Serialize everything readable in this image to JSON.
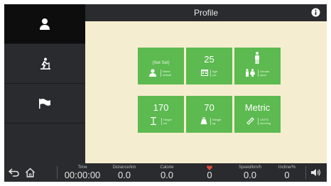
{
  "header": {
    "title": "Profile",
    "info_icon": "info-icon"
  },
  "sidebar": {
    "items": [
      {
        "name": "profile",
        "icon": "user-icon",
        "active": true
      },
      {
        "name": "workout",
        "icon": "treadmill-runner-icon",
        "active": false
      },
      {
        "name": "goals",
        "icon": "flag-icon",
        "active": false
      }
    ]
  },
  "tiles": [
    {
      "value": "(Not Set)",
      "label": "Name",
      "sublabel": "default",
      "icon": "user-icon"
    },
    {
      "value": "25",
      "label": "Age",
      "sublabel": "yrs",
      "icon": "calendar-icon"
    },
    {
      "value": "",
      "label": "Gender",
      "sublabel": "sport",
      "icon": "male-female-icon"
    },
    {
      "value": "170",
      "label": "Height",
      "sublabel": "cm",
      "icon": "height-icon"
    },
    {
      "value": "70",
      "label": "Weight",
      "sublabel": "kg",
      "icon": "weight-icon"
    },
    {
      "value": "Metric",
      "label": "UNITS",
      "sublabel": "km/m/kg",
      "icon": "ruler-icon"
    }
  ],
  "bottombar": {
    "time": {
      "label": "Time",
      "value": "00:00:00"
    },
    "distance": {
      "label": "Distance/km",
      "value": "0.0"
    },
    "calorie": {
      "label": "Calorie",
      "value": "0.0"
    },
    "heart": {
      "value": "0"
    },
    "speed": {
      "label": "Speed/km/h",
      "value": "0.0"
    },
    "incline": {
      "label": "Incline/%",
      "value": "0"
    }
  },
  "colors": {
    "accent_green": "#5cba50",
    "content_bg": "#f5edcf",
    "bar_bg": "#2a2b2e",
    "heart_red": "#e04a3a"
  }
}
